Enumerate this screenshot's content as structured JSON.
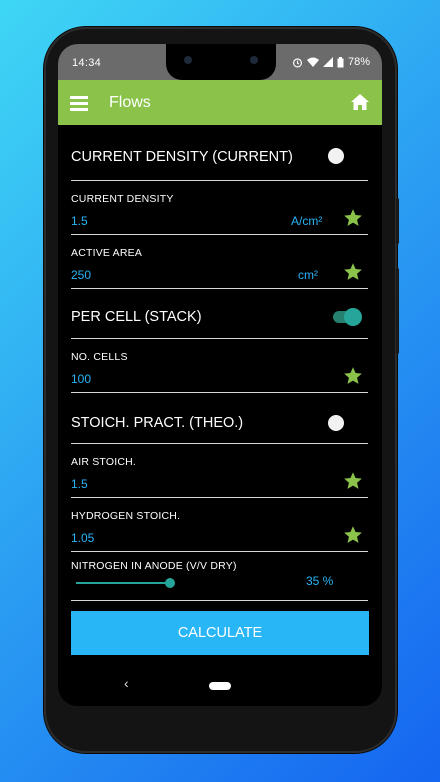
{
  "status": {
    "time": "14:34",
    "battery": "78%"
  },
  "appbar": {
    "title": "Flows"
  },
  "sections": {
    "current_density": {
      "label": "CURRENT DENSITY (CURRENT)",
      "field_label": "CURRENT DENSITY",
      "value": "1.5",
      "unit": "A/cm²"
    },
    "active_area": {
      "field_label": "ACTIVE AREA",
      "value": "250",
      "unit": "cm²"
    },
    "per_cell": {
      "label": "PER CELL (STACK)",
      "toggle_on": true
    },
    "no_cells": {
      "field_label": "NO. CELLS",
      "value": "100"
    },
    "stoich": {
      "label": "STOICH. PRACT. (THEO.)",
      "toggle_on": false
    },
    "air_stoich": {
      "field_label": "AIR STOICH.",
      "value": "1.5"
    },
    "hydrogen_stoich": {
      "field_label": "HYDROGEN STOICH.",
      "value": "1.05"
    },
    "nitrogen": {
      "field_label": "NITROGEN IN ANODE (V/V DRY)",
      "value_text": "35 %",
      "percent": 35
    }
  },
  "calculate_label": "CALCULATE",
  "nav": {
    "back_glyph": "‹"
  },
  "colors": {
    "accent_green": "#8bc34a",
    "value_blue": "#29b6f6",
    "teal": "#26a69a",
    "star": "#8bc34a"
  },
  "icons": [
    "menu-icon",
    "home-icon",
    "star-icon",
    "wifi-icon",
    "signal-icon",
    "battery-icon",
    "alarm-icon"
  ]
}
